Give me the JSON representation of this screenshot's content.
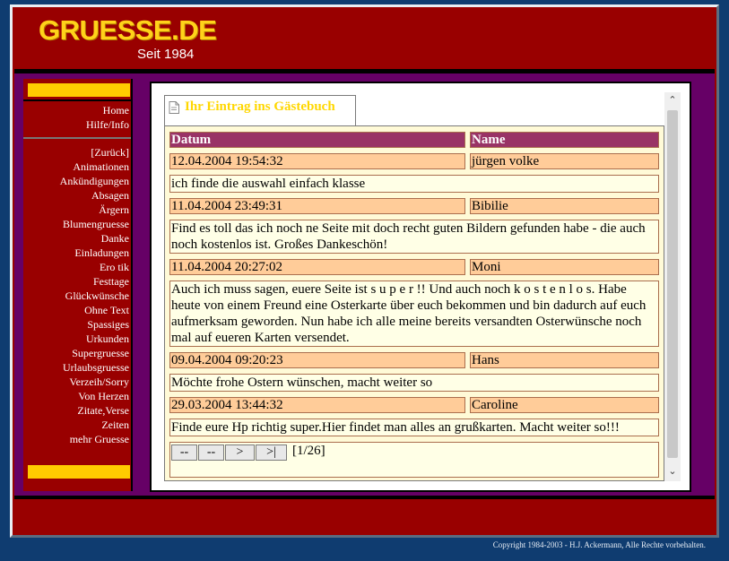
{
  "logo": {
    "title": "GRUESSE.DE",
    "subtitle": "Seit 1984"
  },
  "nav_top": [
    "Home",
    "Hilfe/Info"
  ],
  "nav_main": [
    "[Zurück]",
    "Animationen",
    "Ankündigungen",
    "Absagen",
    "Ärgern",
    "Blumengruesse",
    "Danke",
    "Einladungen",
    "Ero tik",
    "Festtage",
    "Glückwünsche",
    "Ohne Text",
    "Spassiges",
    "Urkunden",
    "Supergruesse",
    "Urlaubsgruesse",
    "Verzeih/Sorry",
    "Von Herzen",
    "Zitate,Verse",
    "Zeiten",
    "mehr Gruesse"
  ],
  "tab": {
    "label": "Ihr Eintrag ins Gästebuch",
    "icon": "document-icon"
  },
  "table": {
    "headers": {
      "date": "Datum",
      "name": "Name"
    },
    "entries": [
      {
        "date": "12.04.2004 19:54:32",
        "name": "jürgen volke",
        "message": "ich finde die auswahl einfach klasse"
      },
      {
        "date": "11.04.2004 23:49:31",
        "name": "Bibilie",
        "message": "Find es toll das ich noch ne Seite mit doch recht guten Bildern gefunden habe - die auch noch kostenlos ist. Großes Dankeschön!"
      },
      {
        "date": "11.04.2004 20:27:02",
        "name": "Moni",
        "message": "Auch ich muss sagen, euere Seite ist s u p e r !! Und auch noch k o s t e n l o s. Habe heute von einem Freund eine Osterkarte über euch bekommen und bin dadurch auf euch aufmerksam geworden. Nun habe ich alle meine bereits versandten Osterwünsche noch mal auf eueren Karten versendet."
      },
      {
        "date": "09.04.2004 09:20:23",
        "name": "Hans",
        "message": "Möchte frohe Ostern wünschen, macht weiter so"
      },
      {
        "date": "29.03.2004 13:44:32",
        "name": "Caroline",
        "message": "Finde eure Hp richtig super.Hier findet man alles an grußkarten. Macht weiter so!!!"
      }
    ]
  },
  "pager": {
    "first": "--",
    "prev": "--",
    "next": ">",
    "last": ">|",
    "info": "[1/26]"
  },
  "copyright": "Copyright 1984-2003 - H.J. Ackermann, Alle Rechte vorbehalten.",
  "colors": {
    "frame": "#990000",
    "band": "#660066",
    "accent": "#ffcc00",
    "header_cell": "#993366",
    "date_cell": "#ffcc99",
    "background": "#0f3c70"
  }
}
